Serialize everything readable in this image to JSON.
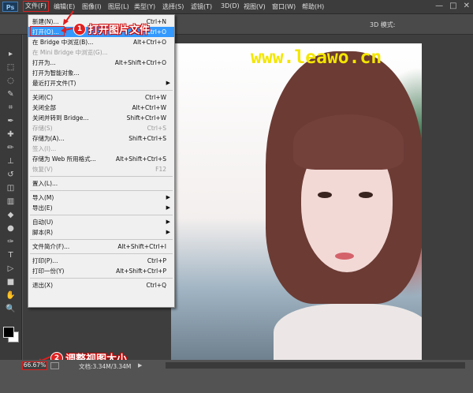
{
  "menubar": {
    "logo": "Ps",
    "items": [
      "文件(F)",
      "编辑(E)",
      "图像(I)",
      "图层(L)",
      "类型(Y)",
      "选择(S)",
      "滤镜(T)",
      "3D(D)",
      "视图(V)",
      "窗口(W)",
      "帮助(H)"
    ],
    "window_buttons": [
      "—",
      "□",
      "✕"
    ]
  },
  "options_bar": {
    "mode_3d": "3D 模式:"
  },
  "file_menu": {
    "items": [
      {
        "label": "新建(N)...",
        "shortcut": "Ctrl+N",
        "disabled": false,
        "submenu": false
      },
      {
        "label": "打开(O)...",
        "shortcut": "Ctrl+O",
        "disabled": false,
        "submenu": false,
        "highlighted": true
      },
      {
        "label": "在 Bridge 中浏览(B)...",
        "shortcut": "Alt+Ctrl+O",
        "disabled": false,
        "submenu": false
      },
      {
        "label": "在 Mini Bridge 中浏览(G)...",
        "shortcut": "",
        "disabled": true,
        "submenu": false
      },
      {
        "label": "打开为...",
        "shortcut": "Alt+Shift+Ctrl+O",
        "disabled": false,
        "submenu": false
      },
      {
        "label": "打开为智能对象...",
        "shortcut": "",
        "disabled": false,
        "submenu": false
      },
      {
        "label": "最近打开文件(T)",
        "shortcut": "",
        "disabled": false,
        "submenu": true
      },
      {
        "separator": true
      },
      {
        "label": "关闭(C)",
        "shortcut": "Ctrl+W",
        "disabled": false,
        "submenu": false
      },
      {
        "label": "关闭全部",
        "shortcut": "Alt+Ctrl+W",
        "disabled": false,
        "submenu": false
      },
      {
        "label": "关闭并转到 Bridge...",
        "shortcut": "Shift+Ctrl+W",
        "disabled": false,
        "submenu": false
      },
      {
        "label": "存储(S)",
        "shortcut": "Ctrl+S",
        "disabled": true,
        "submenu": false
      },
      {
        "label": "存储为(A)...",
        "shortcut": "Shift+Ctrl+S",
        "disabled": false,
        "submenu": false
      },
      {
        "label": "签入(I)...",
        "shortcut": "",
        "disabled": true,
        "submenu": false
      },
      {
        "label": "存储为 Web 所用格式...",
        "shortcut": "Alt+Shift+Ctrl+S",
        "disabled": false,
        "submenu": false
      },
      {
        "label": "恢复(V)",
        "shortcut": "F12",
        "disabled": true,
        "submenu": false
      },
      {
        "separator": true
      },
      {
        "label": "置入(L)...",
        "shortcut": "",
        "disabled": false,
        "submenu": false
      },
      {
        "separator": true
      },
      {
        "label": "导入(M)",
        "shortcut": "",
        "disabled": false,
        "submenu": true
      },
      {
        "label": "导出(E)",
        "shortcut": "",
        "disabled": false,
        "submenu": true
      },
      {
        "separator": true
      },
      {
        "label": "自动(U)",
        "shortcut": "",
        "disabled": false,
        "submenu": true
      },
      {
        "label": "脚本(R)",
        "shortcut": "",
        "disabled": false,
        "submenu": true
      },
      {
        "separator": true
      },
      {
        "label": "文件简介(F)...",
        "shortcut": "Alt+Shift+Ctrl+I",
        "disabled": false,
        "submenu": false
      },
      {
        "separator": true
      },
      {
        "label": "打印(P)...",
        "shortcut": "Ctrl+P",
        "disabled": false,
        "submenu": false
      },
      {
        "label": "打印一份(Y)",
        "shortcut": "Alt+Shift+Ctrl+P",
        "disabled": false,
        "submenu": false
      },
      {
        "separator": true
      },
      {
        "label": "退出(X)",
        "shortcut": "Ctrl+Q",
        "disabled": false,
        "submenu": false
      }
    ]
  },
  "annotations": {
    "step1": {
      "number": "1",
      "text": "打开图片文件"
    },
    "step2": {
      "number": "2",
      "text": "调整视图大小"
    },
    "color": "#e02020"
  },
  "watermark": "www.leawo.cn",
  "statusbar": {
    "zoom": "66.67%",
    "doc_size": "文档:3.34M/3.34M",
    "arrow": "▶"
  },
  "tools": [
    "move-tool-icon",
    "marquee-tool-icon",
    "lasso-tool-icon",
    "quick-select-tool-icon",
    "crop-tool-icon",
    "eyedropper-tool-icon",
    "healing-brush-tool-icon",
    "brush-tool-icon",
    "clone-stamp-tool-icon",
    "history-brush-tool-icon",
    "eraser-tool-icon",
    "gradient-tool-icon",
    "blur-tool-icon",
    "dodge-tool-icon",
    "pen-tool-icon",
    "type-tool-icon",
    "path-select-tool-icon",
    "shape-tool-icon",
    "hand-tool-icon",
    "zoom-tool-icon"
  ],
  "tool_glyphs": [
    "▸",
    "⬚",
    "◌",
    "✎",
    "⌗",
    "✒",
    "✚",
    "✏",
    "⊥",
    "↺",
    "◫",
    "▥",
    "◆",
    "●",
    "✑",
    "T",
    "▷",
    "■",
    "✋",
    "🔍"
  ]
}
